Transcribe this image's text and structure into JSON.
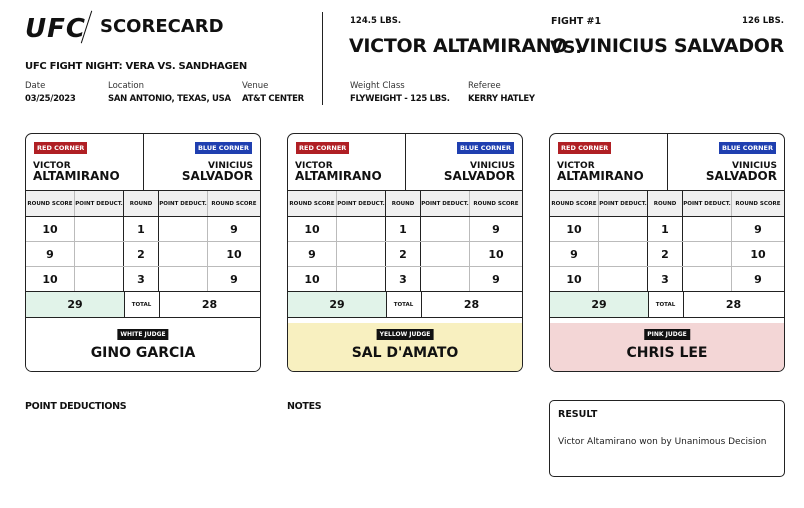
{
  "header": {
    "logo": "UFC",
    "title": "SCORECARD",
    "event": "UFC FIGHT NIGHT: VERA VS. SANDHAGEN",
    "date_label": "Date",
    "date": "03/25/2023",
    "location_label": "Location",
    "location": "SAN ANTONIO, TEXAS, USA",
    "venue_label": "Venue",
    "venue": "AT&T CENTER"
  },
  "bout": {
    "red_weight": "124.5 LBS.",
    "red_name": "VICTOR ALTAMIRANO",
    "fight_no": "FIGHT #1",
    "vs": "VS.",
    "blue_weight": "126 LBS.",
    "blue_name": "VINICIUS SALVADOR",
    "weight_class_label": "Weight Class",
    "weight_class": "FLYWEIGHT - 125 LBS.",
    "referee_label": "Referee",
    "referee": "KERRY HATLEY"
  },
  "labels": {
    "red_corner": "RED CORNER",
    "blue_corner": "BLUE CORNER",
    "red_first": "VICTOR",
    "red_last": "ALTAMIRANO",
    "blue_first": "VINICIUS",
    "blue_last": "SALVADOR",
    "round_score": "ROUND SCORE",
    "point_deduct": "POINT DEDUCT.",
    "round": "ROUND",
    "total": "TOTAL"
  },
  "cards": [
    {
      "judge_tag": "WHITE JUDGE",
      "judge_name": "GINO GARCIA",
      "color": "#ffffff",
      "rounds": [
        {
          "n": "1",
          "red": "10",
          "blue": "9"
        },
        {
          "n": "2",
          "red": "9",
          "blue": "10"
        },
        {
          "n": "3",
          "red": "10",
          "blue": "9"
        }
      ],
      "red_total": "29",
      "blue_total": "28"
    },
    {
      "judge_tag": "YELLOW JUDGE",
      "judge_name": "SAL D'AMATO",
      "color": "#f8f0c0",
      "rounds": [
        {
          "n": "1",
          "red": "10",
          "blue": "9"
        },
        {
          "n": "2",
          "red": "9",
          "blue": "10"
        },
        {
          "n": "3",
          "red": "10",
          "blue": "9"
        }
      ],
      "red_total": "29",
      "blue_total": "28"
    },
    {
      "judge_tag": "PINK JUDGE",
      "judge_name": "CHRIS LEE",
      "color": "#f3d6d6",
      "rounds": [
        {
          "n": "1",
          "red": "10",
          "blue": "9"
        },
        {
          "n": "2",
          "red": "9",
          "blue": "10"
        },
        {
          "n": "3",
          "red": "10",
          "blue": "9"
        }
      ],
      "red_total": "29",
      "blue_total": "28"
    }
  ],
  "footer": {
    "point_deductions": "POINT DEDUCTIONS",
    "notes": "NOTES",
    "result_title": "RESULT",
    "result_text": "Victor Altamirano won by Unanimous Decision"
  }
}
